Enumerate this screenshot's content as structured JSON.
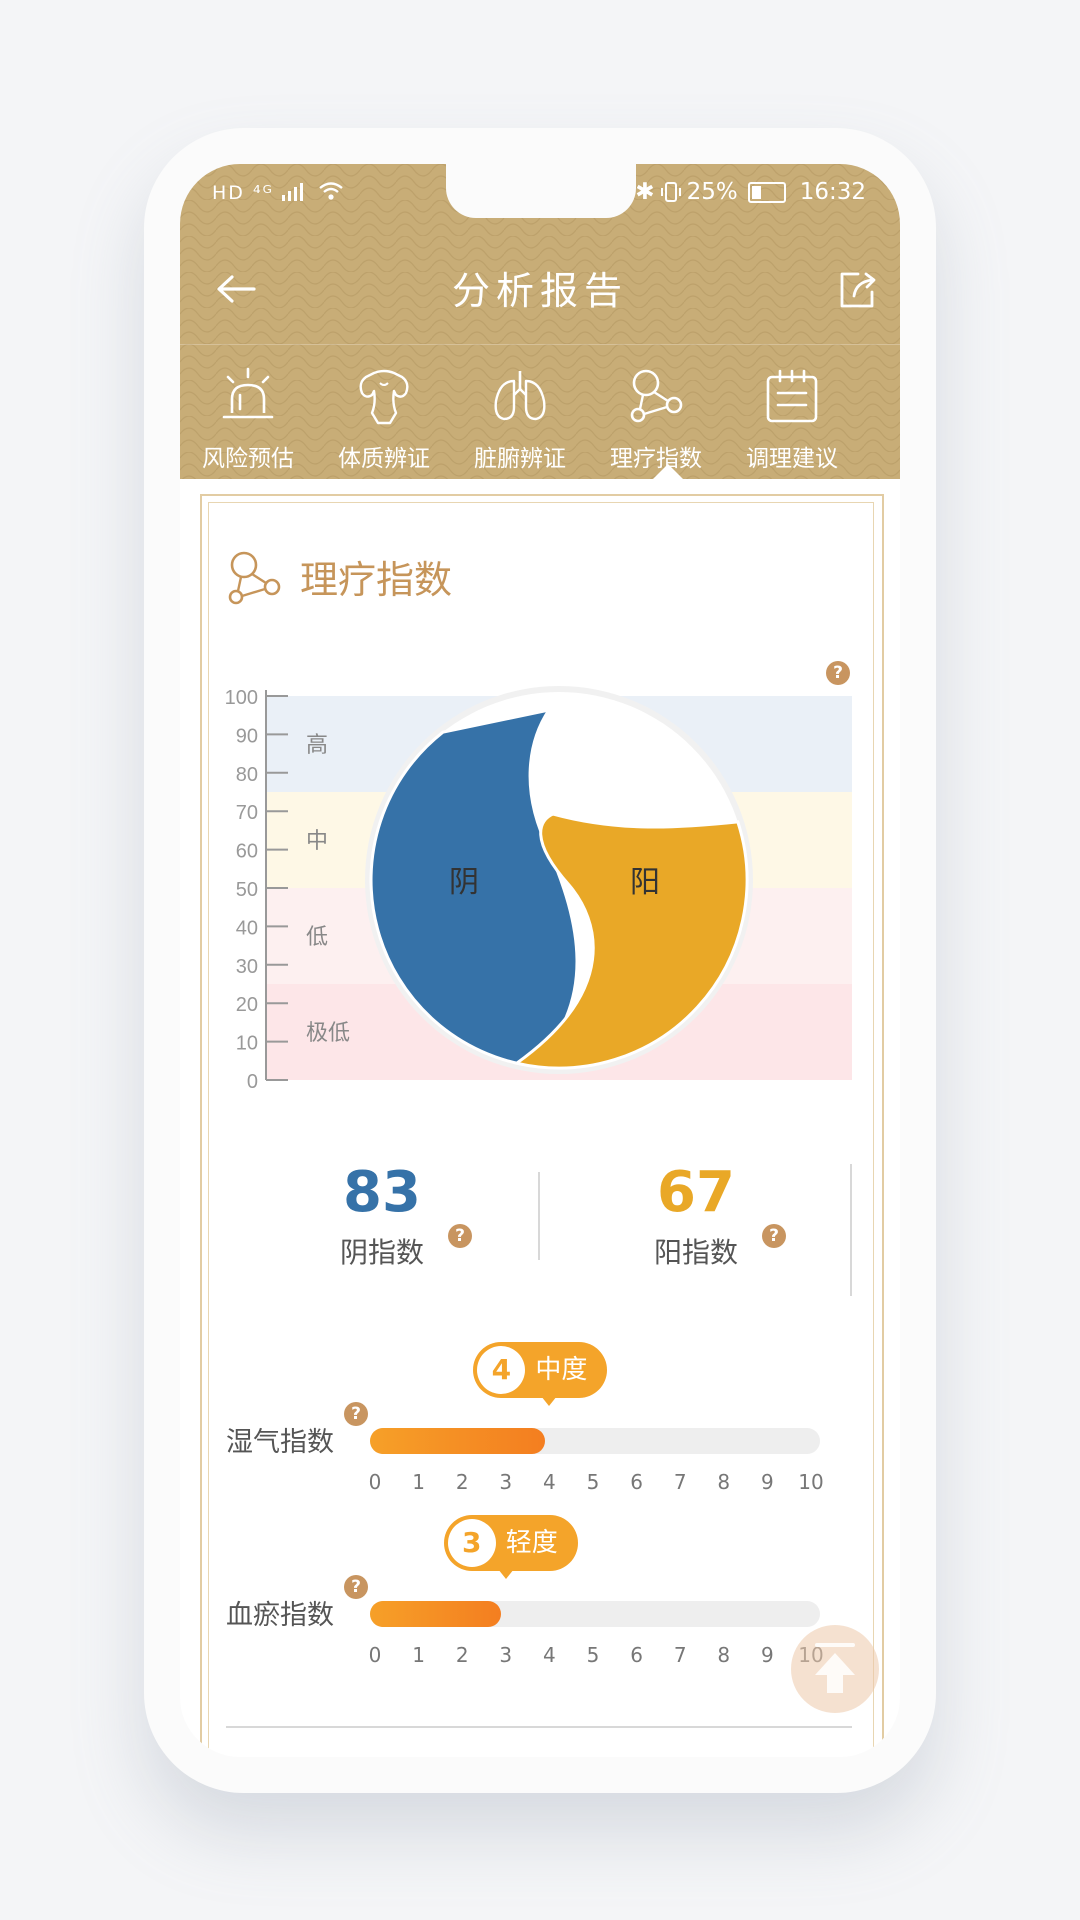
{
  "status_bar": {
    "left_indicators": "HD ⁴ᴳ",
    "bluetooth": "✱",
    "battery_text": "25%",
    "time": "16:32"
  },
  "nav": {
    "title": "分析报告",
    "back_icon": "arrow-left-icon",
    "share_icon": "share-icon"
  },
  "tabs": [
    {
      "label": "风险预估",
      "icon": "alarm-light-icon",
      "active": false
    },
    {
      "label": "体质辨证",
      "icon": "muscle-body-icon",
      "active": false
    },
    {
      "label": "脏腑辨证",
      "icon": "lungs-icon",
      "active": false
    },
    {
      "label": "理疗指数",
      "icon": "molecule-icon",
      "active": true
    },
    {
      "label": "调理建议",
      "icon": "notepad-icon",
      "active": false
    }
  ],
  "section": {
    "title": "理疗指数",
    "icon": "molecule-icon"
  },
  "chart_data": {
    "type": "yin-yang",
    "y_ticks": [
      "100",
      "90",
      "80",
      "70",
      "60",
      "50",
      "40",
      "30",
      "20",
      "10",
      "0"
    ],
    "ylim": [
      0,
      100
    ],
    "bands": [
      {
        "label": "高",
        "range": [
          75,
          100
        ],
        "color": "#eaf0f7"
      },
      {
        "label": "中",
        "range": [
          50,
          75
        ],
        "color": "#fef8e6"
      },
      {
        "label": "低",
        "range": [
          25,
          50
        ],
        "color": "#fdf0f0"
      },
      {
        "label": "极低",
        "range": [
          0,
          25
        ],
        "color": "#fde6e8"
      }
    ],
    "series": [
      {
        "name": "阴",
        "value": 83,
        "color": "#3672a8"
      },
      {
        "name": "阳",
        "value": 67,
        "color": "#e9a827"
      }
    ]
  },
  "scores": {
    "yin": {
      "value": "83",
      "label": "阴指数",
      "color": "#3672a8"
    },
    "yang": {
      "value": "67",
      "label": "阳指数",
      "color": "#e9a827"
    }
  },
  "help_mark": "?",
  "indices": [
    {
      "label": "湿气指数",
      "value": 4,
      "value_text": "4",
      "level": "中度",
      "max": 10
    },
    {
      "label": "血瘀指数",
      "value": 3,
      "value_text": "3",
      "level": "轻度",
      "max": 10
    }
  ],
  "scale_ticks": [
    "0",
    "1",
    "2",
    "3",
    "4",
    "5",
    "6",
    "7",
    "8",
    "9",
    "10"
  ],
  "float_button_icon": "back-to-top-icon"
}
